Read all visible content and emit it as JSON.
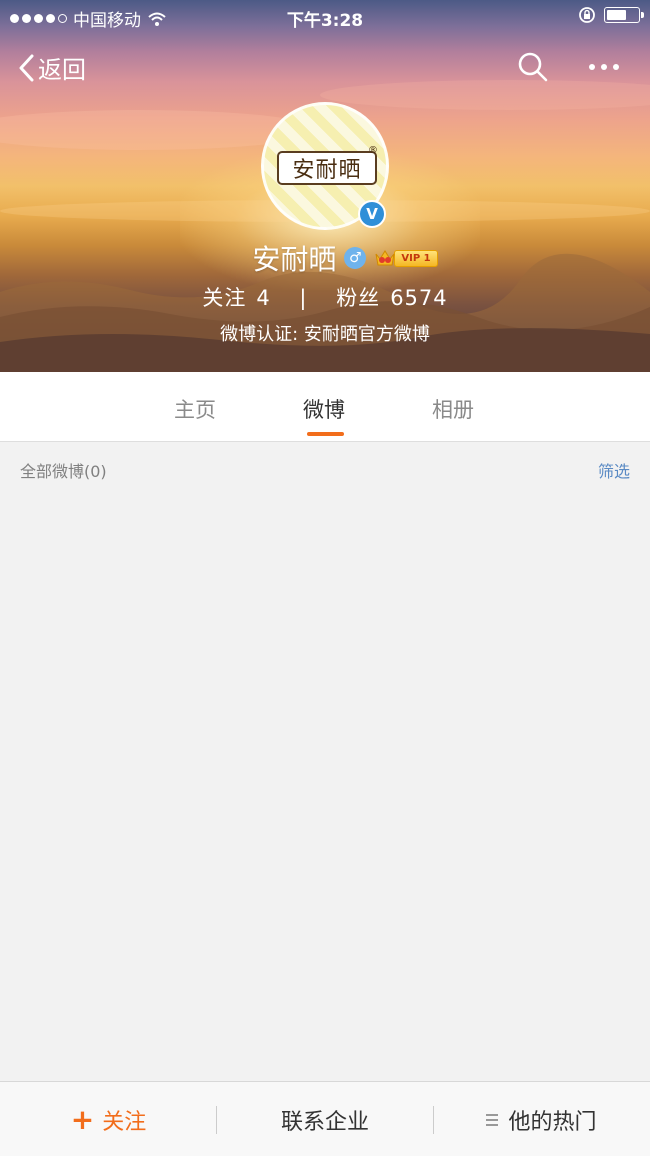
{
  "status_bar": {
    "carrier": "中国移动",
    "time": "下午3:28"
  },
  "nav": {
    "back_label": "返回"
  },
  "profile": {
    "avatar_logo_text": "安耐晒",
    "verified_mark": "V",
    "name": "安耐晒",
    "gender_symbol": "♂",
    "vip_label": "VIP 1",
    "following_label": "关注",
    "following_count": "4",
    "separator": "|",
    "followers_label": "粉丝",
    "followers_count": "6574",
    "certification": "微博认证: 安耐晒官方微博"
  },
  "tabs": [
    {
      "label": "主页",
      "active": false
    },
    {
      "label": "微博",
      "active": true
    },
    {
      "label": "相册",
      "active": false
    }
  ],
  "list": {
    "title": "全部微博(0)",
    "filter_label": "筛选"
  },
  "bottom_bar": {
    "follow_plus": "+",
    "follow_label": "关注",
    "contact_label": "联系企业",
    "hot_label": "他的热门"
  },
  "colors": {
    "accent": "#f26d1b",
    "link": "#5a8ac4",
    "verified": "#2f8fd8"
  }
}
